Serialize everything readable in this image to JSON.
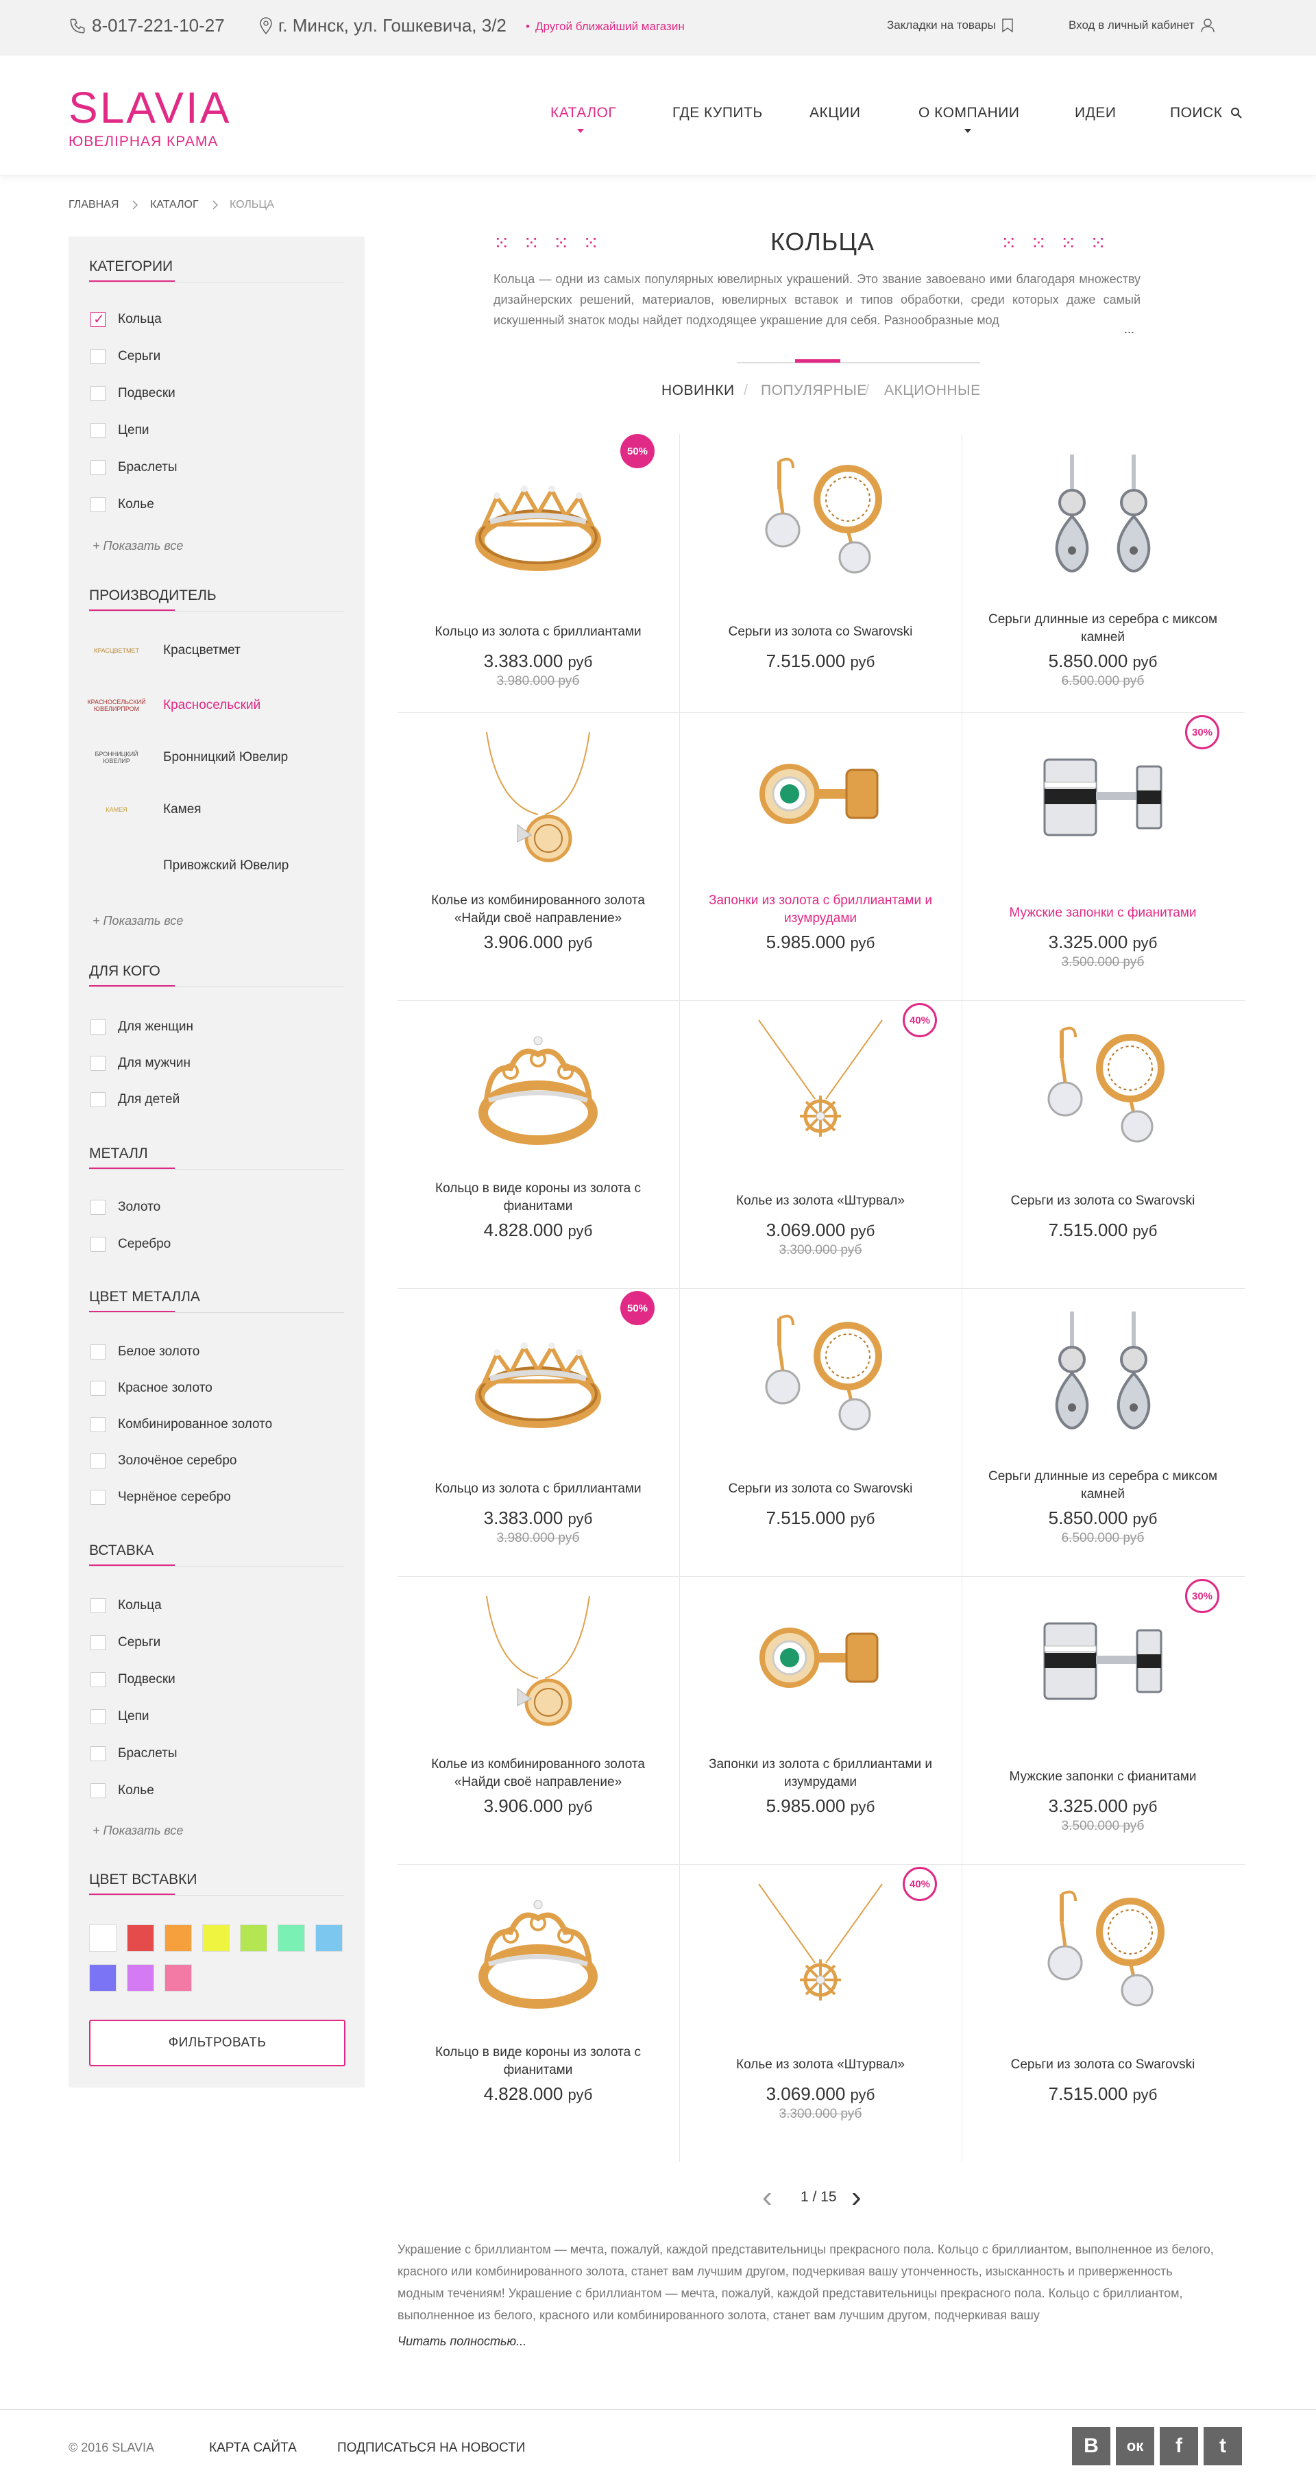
{
  "topbar": {
    "phone": "8-017-221-10-27",
    "address": "г. Минск, ул. Гошкевича, 3/2",
    "other_store": "Другой ближайший магазин",
    "bookmarks": "Закладки на товары",
    "login": "Вход в личный кабинет"
  },
  "header": {
    "logo_main": "SLAVIA",
    "logo_sub": "ЮВЕЛІРНАЯ КРАМА",
    "nav": [
      "КАТАЛОГ",
      "ГДЕ КУПИТЬ",
      "АКЦИИ",
      "О КОМПАНИИ",
      "ИДЕИ",
      "ПОИСК"
    ]
  },
  "breadcrumb": [
    "ГЛАВНАЯ",
    "КАТАЛОГ",
    "КОЛЬЦА"
  ],
  "sidebar": {
    "categories": {
      "title": "КАТЕГОРИИ",
      "items": [
        "Кольца",
        "Серьги",
        "Подвески",
        "Цепи",
        "Браслеты",
        "Колье"
      ],
      "checked": 0,
      "show_all": "Показать все"
    },
    "manufacturer": {
      "title": "ПРОИЗВОДИТЕЛЬ",
      "items": [
        "Красцветмет",
        "Красносельский",
        "Бронницкий Ювелир",
        "Камея",
        "Привожский Ювелир"
      ],
      "logo_texts": [
        "КРАСЦВЕТМЕТ",
        "КРАСНОСЕЛЬСКИЙ ЮВЕЛИРПРОМ",
        "БРОННИЦКИЙ ЮВЕЛИР",
        "КАМЕЯ",
        ""
      ],
      "active": 1,
      "show_all": "Показать все"
    },
    "for_whom": {
      "title": "ДЛЯ КОГО",
      "items": [
        "Для женщин",
        "Для мужчин",
        "Для детей"
      ]
    },
    "metal": {
      "title": "МЕТАЛЛ",
      "items": [
        "Золото",
        "Серебро"
      ]
    },
    "metal_color": {
      "title": "ЦВЕТ МЕТАЛЛА",
      "items": [
        "Белое золото",
        "Красное золото",
        "Комбинированное золото",
        "Золочёное серебро",
        "Чернёное серебро"
      ]
    },
    "insert": {
      "title": "ВСТАВКА",
      "items": [
        "Кольца",
        "Серьги",
        "Подвески",
        "Цепи",
        "Браслеты",
        "Колье"
      ],
      "show_all": "Показать все"
    },
    "insert_color": {
      "title": "ЦВЕТ ВСТАВКИ",
      "colors": [
        "#ffffff",
        "#e54b4b",
        "#f5a03c",
        "#eef43f",
        "#b4e651",
        "#7af0b4",
        "#7cc7ef",
        "#7b74f5",
        "#d47af2",
        "#f27aa5"
      ]
    },
    "filter_button": "ФИЛЬТРОВАТЬ"
  },
  "main": {
    "title": "КОЛЬЦА",
    "intro": "Кольца — одни из самых популярных ювелирных украшений. Это звание завоевано ими благодаря множеству дизайнерских решений, материалов, ювелирных вставок и типов обработки, среди которых даже самый искушенный знаток моды найдет подходящее украшение для себя. Разнообразные мод",
    "intro_more": "...",
    "tabs": [
      "НОВИНКИ",
      "ПОПУЛЯРНЫЕ",
      "АКЦИОННЫЕ"
    ],
    "products": [
      {
        "name": "Кольцо из золота с бриллиантами",
        "price": "3.383.000",
        "old": "3.980.000 руб",
        "badge": "50%",
        "badge_style": "filled",
        "img": "ring-crown",
        "pink": false
      },
      {
        "name": "Серьги из золота со Swarovski",
        "price": "7.515.000",
        "old": "",
        "badge": "",
        "badge_style": "",
        "img": "earrings-gold",
        "pink": false
      },
      {
        "name": "Серьги длинные из серебра с миксом камней",
        "price": "5.850.000",
        "old": "6.500.000 руб",
        "badge": "",
        "badge_style": "",
        "img": "earrings-silver",
        "pink": false
      },
      {
        "name": "Колье из комбинированного золота «Найди своё направление»",
        "price": "3.906.000",
        "old": "",
        "badge": "",
        "badge_style": "",
        "img": "necklace-coin",
        "pink": false
      },
      {
        "name": "Запонки из золота с бриллиантами и изумрудами",
        "price": "5.985.000",
        "old": "",
        "badge": "",
        "badge_style": "",
        "img": "cufflinks-gold",
        "pink": true
      },
      {
        "name": "Мужские запонки с фианитами",
        "price": "3.325.000",
        "old": "3.500.000 руб",
        "badge": "30%",
        "badge_style": "outline",
        "img": "cufflinks-silver",
        "pink": true
      },
      {
        "name": "Кольцо в виде короны из золота с фианитами",
        "price": "4.828.000",
        "old": "",
        "badge": "",
        "badge_style": "",
        "img": "ring-tiara",
        "pink": false
      },
      {
        "name": "Колье из золота «Штурвал»",
        "price": "3.069.000",
        "old": "3.300.000 руб",
        "badge": "40%",
        "badge_style": "outline",
        "img": "necklace-wheel",
        "pink": false
      },
      {
        "name": "Серьги из золота со Swarovski",
        "price": "7.515.000",
        "old": "",
        "badge": "",
        "badge_style": "",
        "img": "earrings-gold",
        "pink": false
      },
      {
        "name": "Кольцо из золота с бриллиантами",
        "price": "3.383.000",
        "old": "3.980.000 руб",
        "badge": "50%",
        "badge_style": "filled",
        "img": "ring-crown",
        "pink": false
      },
      {
        "name": "Серьги из золота со Swarovski",
        "price": "7.515.000",
        "old": "",
        "badge": "",
        "badge_style": "",
        "img": "earrings-gold",
        "pink": false
      },
      {
        "name": "Серьги длинные из серебра с миксом камней",
        "price": "5.850.000",
        "old": "6.500.000 руб",
        "badge": "",
        "badge_style": "",
        "img": "earrings-silver",
        "pink": false
      },
      {
        "name": "Колье из комбинированного золота «Найди своё направление»",
        "price": "3.906.000",
        "old": "",
        "badge": "",
        "badge_style": "",
        "img": "necklace-coin",
        "pink": false
      },
      {
        "name": "Запонки из золота с бриллиантами и изумрудами",
        "price": "5.985.000",
        "old": "",
        "badge": "",
        "badge_style": "",
        "img": "cufflinks-gold",
        "pink": false
      },
      {
        "name": "Мужские запонки с фианитами",
        "price": "3.325.000",
        "old": "3.500.000 руб",
        "badge": "30%",
        "badge_style": "outline",
        "img": "cufflinks-silver",
        "pink": false
      },
      {
        "name": "Кольцо в виде короны из золота с фианитами",
        "price": "4.828.000",
        "old": "",
        "badge": "",
        "badge_style": "",
        "img": "ring-tiara",
        "pink": false
      },
      {
        "name": "Колье из золота «Штурвал»",
        "price": "3.069.000",
        "old": "3.300.000 руб",
        "badge": "40%",
        "badge_style": "outline",
        "img": "necklace-wheel",
        "pink": false
      },
      {
        "name": "Серьги из золота со Swarovski",
        "price": "7.515.000",
        "old": "",
        "badge": "",
        "badge_style": "",
        "img": "earrings-gold",
        "pink": false
      }
    ],
    "currency": "руб",
    "pagination": "1 / 15",
    "seo_text": "Украшение с бриллиантом — мечта, пожалуй, каждой представительницы прекрасного пола. Кольцо с бриллиантом, выполненное из белого, красного или комбинированного золота, станет вам лучшим другом, подчеркивая вашу утонченность, изысканность и приверженность модным течениям! Украшение с бриллиантом — мечта, пожалуй, каждой представительницы прекрасного пола. Кольцо с бриллиантом, выполненное из белого, красного или комбинированного золота, станет вам лучшим другом, подчеркивая вашу",
    "seo_more": "Читать полностью..."
  },
  "footer": {
    "copyright": "© 2016 SLAVIA",
    "sitemap": "КАРТА САЙТА",
    "subscribe": "ПОДПИСАТЬСЯ НА НОВОСТИ",
    "social": [
      "vk-icon",
      "odnoklassniki-icon",
      "facebook-icon",
      "twitter-icon"
    ],
    "social_glyphs": [
      "В",
      "ок",
      "f",
      "t"
    ]
  },
  "colors": {
    "accent": "#e02a85",
    "gold": "#e0a04a",
    "silver": "#b9bcc2"
  }
}
